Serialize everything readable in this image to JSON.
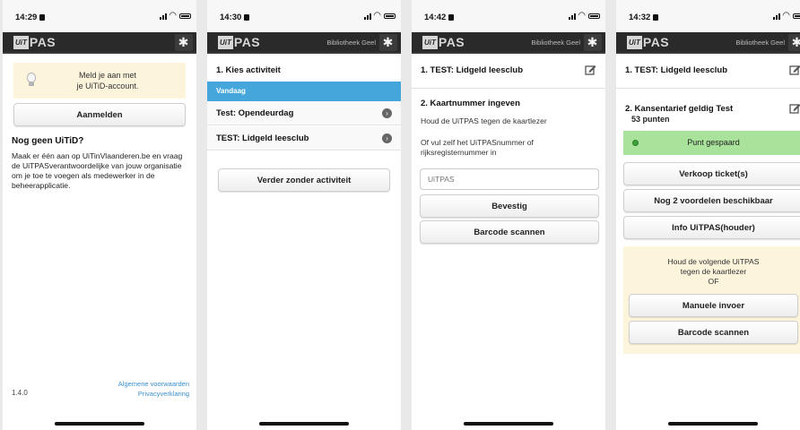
{
  "brand": {
    "uit": "UiT",
    "pas": "PAS"
  },
  "screens": [
    {
      "time": "14:29",
      "location": "",
      "login_line1": "Meld je aan met",
      "login_line2": "je UiTiD-account.",
      "login_button": "Aanmelden",
      "no_account_heading": "Nog geen UiTiD?",
      "no_account_text": "Maak er één aan op UiTinVlaanderen.be en vraag de UiTPASverantwoordelijke van jouw organisatie om je toe te voegen als medewerker in de beheerapplicatie.",
      "version": "1.4.0",
      "terms_link": "Algemene voorwaarden",
      "privacy_link": "Privacyverklaring"
    },
    {
      "time": "14:30",
      "location": "Bibliotheek Geel",
      "heading": "1. Kies activiteit",
      "day_label": "Vandaag",
      "activities": [
        "Test: Opendeurdag",
        "TEST: Lidgeld leesclub"
      ],
      "continue_button": "Verder zonder activiteit"
    },
    {
      "time": "14:42",
      "location": "Bibliotheek Geel",
      "step1": "1. TEST: Lidgeld leesclub",
      "step2": "2. Kaartnummer ingeven",
      "instruction1": "Houd de UiTPAS tegen de kaartlezer",
      "instruction2": "Of vul zelf het UiTPASnummer of rijksregisternummer in",
      "input_placeholder": "UiTPAS",
      "confirm_button": "Bevestig",
      "scan_button": "Barcode scannen"
    },
    {
      "time": "14:32",
      "location": "Bibliotheek Geel",
      "step1": "1. TEST: Lidgeld leesclub",
      "step2": "2. Kansentarief geldig Test",
      "points": "53 punten",
      "success_message": "Punt gespaard",
      "sell_button": "Verkoop ticket(s)",
      "benefits_button": "Nog 2 voordelen beschikbaar",
      "info_button": "Info UiTPAS(houder)",
      "next_line1": "Houd de volgende UiTPAS",
      "next_line2": "tegen de kaartlezer",
      "next_line3": "OF",
      "manual_button": "Manuele invoer",
      "scan_button": "Barcode scannen"
    }
  ],
  "colors": {
    "app_bar": "#2a2a2a",
    "accent_blue": "#45a6db",
    "success_green": "#a8e29b",
    "notice_yellow": "#fdf4dc",
    "link_blue": "#3a8fd0"
  }
}
